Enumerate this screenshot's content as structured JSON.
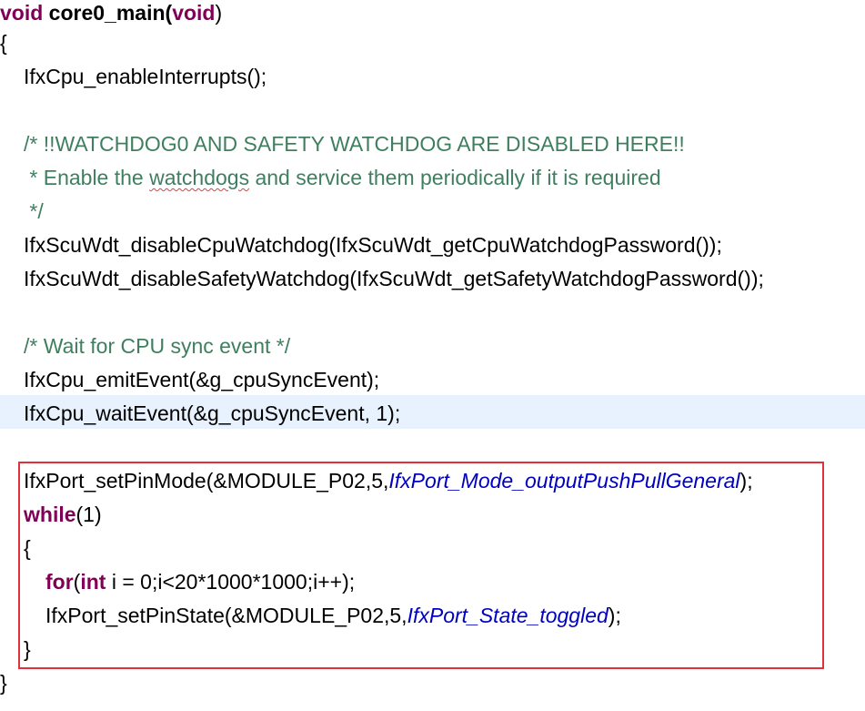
{
  "code": {
    "kw_void": "void",
    "fn_name": " core0_main(",
    "kw_void_param": "void",
    "close_paren": ")",
    "open_brace": "{",
    "enable_interrupts": "IfxCpu_enableInterrupts();",
    "comment_1": "/* !!WATCHDOG0 AND SAFETY WATCHDOG ARE DISABLED HERE!!",
    "comment_2a": " * Enable the ",
    "comment_2b": "watchdogs",
    "comment_2c": " and service them periodically if it is required",
    "comment_3": " */",
    "disable_cpu_wdt": "IfxScuWdt_disableCpuWatchdog(IfxScuWdt_getCpuWatchdogPassword());",
    "disable_safety_wdt": "IfxScuWdt_disableSafetyWatchdog(IfxScuWdt_getSafetyWatchdogPassword());",
    "comment_sync": "/* Wait for CPU sync event */",
    "emit_event": "IfxCpu_emitEvent(&g_cpuSyncEvent);",
    "wait_event": "IfxCpu_waitEvent(&g_cpuSyncEvent, 1);",
    "set_pin_mode_a": "IfxPort_setPinMode(&MODULE_P02,5,",
    "set_pin_mode_enum": "IfxPort_Mode_outputPushPullGeneral",
    "set_pin_mode_b": ");",
    "kw_while": "while",
    "while_cond": "(1)",
    "inner_open_brace": "{",
    "kw_for": "for",
    "for_paren": "(",
    "kw_int": "int",
    "for_rest": " i = 0;i<20*1000*1000;i++);",
    "set_pin_state_a": "IfxPort_setPinState(&MODULE_P02,5,",
    "set_pin_state_enum": "IfxPort_State_toggled",
    "set_pin_state_b": ");",
    "inner_close_brace": "}",
    "close_brace": "}"
  },
  "colors": {
    "keyword": "#7f0055",
    "comment": "#3f7f5f",
    "enum_constant": "#0000c0",
    "current_line_highlight": "#e8f2fe",
    "annotation_box": "#e0313d"
  }
}
